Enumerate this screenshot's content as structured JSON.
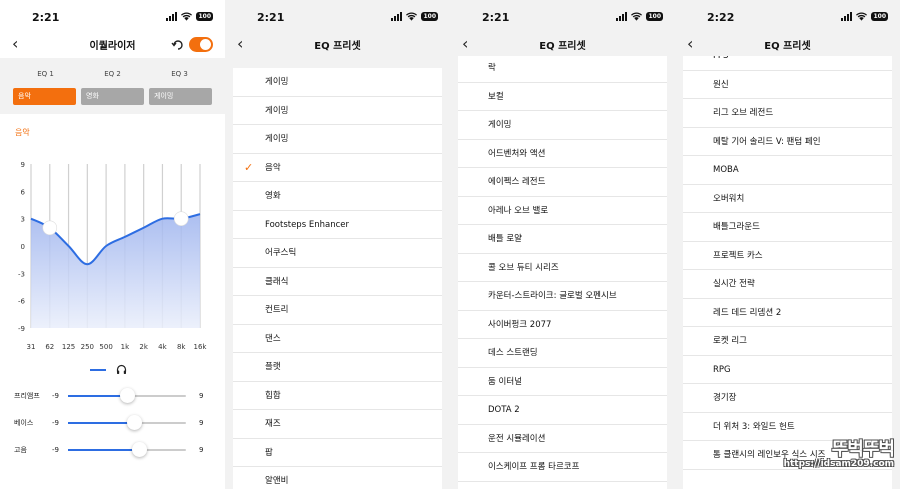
{
  "screens": [
    {
      "time": "2:21",
      "battery": "100",
      "title": "이퀄라이저",
      "eq_labels": [
        "EQ 1",
        "EQ 2",
        "EQ 3"
      ],
      "eq_presets": [
        "음악",
        "영화",
        "게이밍"
      ],
      "active_preset": "음악",
      "sliders": [
        {
          "label": "프리앰프",
          "min": "-9",
          "max": "9",
          "value": 0
        },
        {
          "label": "베이스",
          "min": "-9",
          "max": "9",
          "value": 1
        },
        {
          "label": "고음",
          "min": "-9",
          "max": "9",
          "value": 1.8
        }
      ]
    },
    {
      "time": "2:21",
      "battery": "100",
      "title": "EQ 프리셋",
      "items": [
        "게이밍",
        "게이밍",
        "게이밍",
        "음악",
        "영화",
        "Footsteps Enhancer",
        "어쿠스틱",
        "클래식",
        "컨트리",
        "댄스",
        "플랫",
        "힙합",
        "재즈",
        "팝",
        "알앤비"
      ],
      "checked": "음악"
    },
    {
      "time": "2:21",
      "battery": "100",
      "title": "EQ 프리셋",
      "items": [
        "락",
        "보컬",
        "게이밍",
        "어드벤처와 액션",
        "에이펙스 레전드",
        "아레나 오브 밸로",
        "배틀 로얄",
        "콜 오브 듀티 시리즈",
        "카운터-스트라이크: 글로벌 오펜시브",
        "사이버펑크 2077",
        "데스 스트랜딩",
        "둠 이터널",
        "DOTA 2",
        "운전 시뮬레이션",
        "이스케이프 프롬 타르코프"
      ]
    },
    {
      "time": "2:22",
      "battery": "100",
      "title": "EQ 프리셋",
      "items": [
        "FPS",
        "원신",
        "리그 오브 레전드",
        "메탈 기어 솔리드 V: 팬텀 페인",
        "MOBA",
        "오버워치",
        "배틀그라운드",
        "프로젝트 카스",
        "실시간 전략",
        "레드 데드 리뎀션 2",
        "로켓 리그",
        "RPG",
        "경기장",
        "더 위처 3: 와일드 헌트",
        "톰 클랜시의 레인보우 식스 시즈"
      ]
    }
  ],
  "chart_data": {
    "type": "line",
    "x": [
      "31",
      "62",
      "125",
      "250",
      "500",
      "1k",
      "2k",
      "4k",
      "8k",
      "16k"
    ],
    "values": [
      3,
      2,
      0,
      -2,
      0,
      1,
      2,
      3,
      3,
      3.5
    ],
    "yticks": [
      "9",
      "6",
      "3",
      "0",
      "-3",
      "-6",
      "-9"
    ],
    "ylim": [
      -9,
      9
    ],
    "handles": [
      {
        "x": "62",
        "y": 2
      },
      {
        "x": "8k",
        "y": 3
      }
    ],
    "colors": {
      "line": "#2d6de2",
      "fill_top": "#9db3ee",
      "fill_bottom": "#e9eefb",
      "accent": "#f36f0e"
    }
  },
  "watermark": {
    "text": "뚜벅뚜벅",
    "url": "https://idsam209.com"
  }
}
